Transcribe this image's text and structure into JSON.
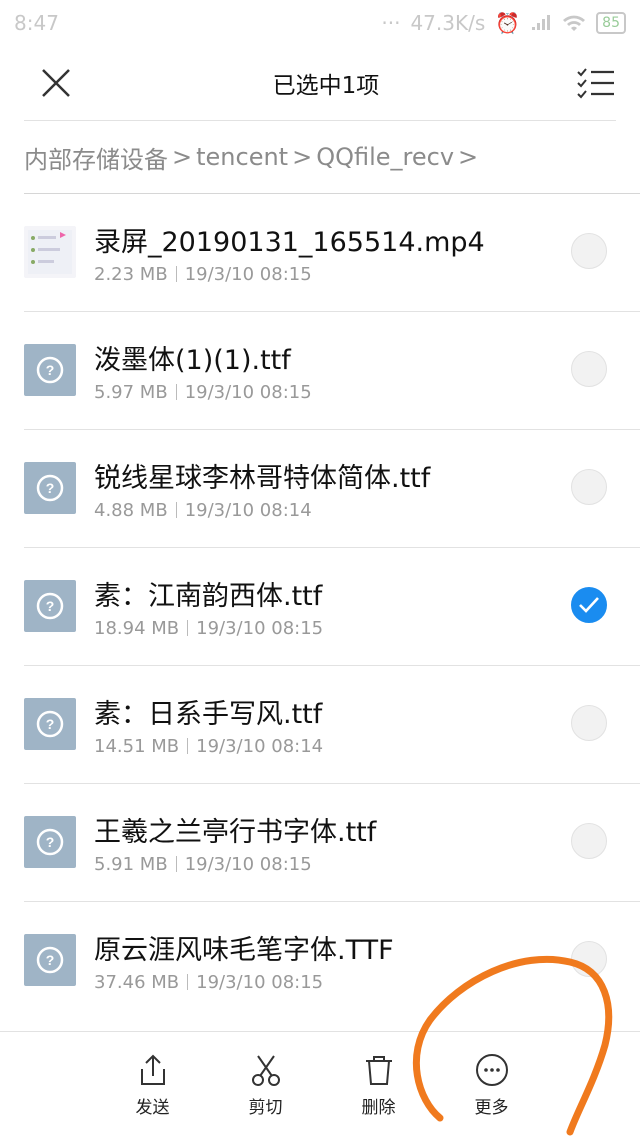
{
  "status": {
    "time": "8:47",
    "speed": "47.3K/s",
    "battery": "85"
  },
  "header": {
    "title": "已选中1项"
  },
  "breadcrumb": [
    "内部存储设备",
    "tencent",
    "QQfile_recv"
  ],
  "files": [
    {
      "name": "录屏_20190131_165514.mp4",
      "size": "2.23 MB",
      "date": "19/3/10 08:15",
      "type": "video",
      "selected": false
    },
    {
      "name": "泼墨体(1)(1).ttf",
      "size": "5.97 MB",
      "date": "19/3/10 08:15",
      "type": "unknown",
      "selected": false
    },
    {
      "name": "锐线星球李林哥特体简体.ttf",
      "size": "4.88 MB",
      "date": "19/3/10 08:14",
      "type": "unknown",
      "selected": false
    },
    {
      "name": "素：江南韵西体.ttf",
      "size": "18.94 MB",
      "date": "19/3/10 08:15",
      "type": "unknown",
      "selected": true
    },
    {
      "name": "素：日系手写风.ttf",
      "size": "14.51 MB",
      "date": "19/3/10 08:14",
      "type": "unknown",
      "selected": false
    },
    {
      "name": "王羲之兰亭行书字体.ttf",
      "size": "5.91 MB",
      "date": "19/3/10 08:15",
      "type": "unknown",
      "selected": false
    },
    {
      "name": "原云涯风味毛笔字体.TTF",
      "size": "37.46 MB",
      "date": "19/3/10 08:15",
      "type": "unknown",
      "selected": false
    }
  ],
  "actions": {
    "send": "发送",
    "cut": "剪切",
    "delete": "删除",
    "more": "更多"
  },
  "colors": {
    "accent": "#1a8cf0",
    "annotation": "#f07a1e",
    "file_icon": "#9fb4c6"
  }
}
